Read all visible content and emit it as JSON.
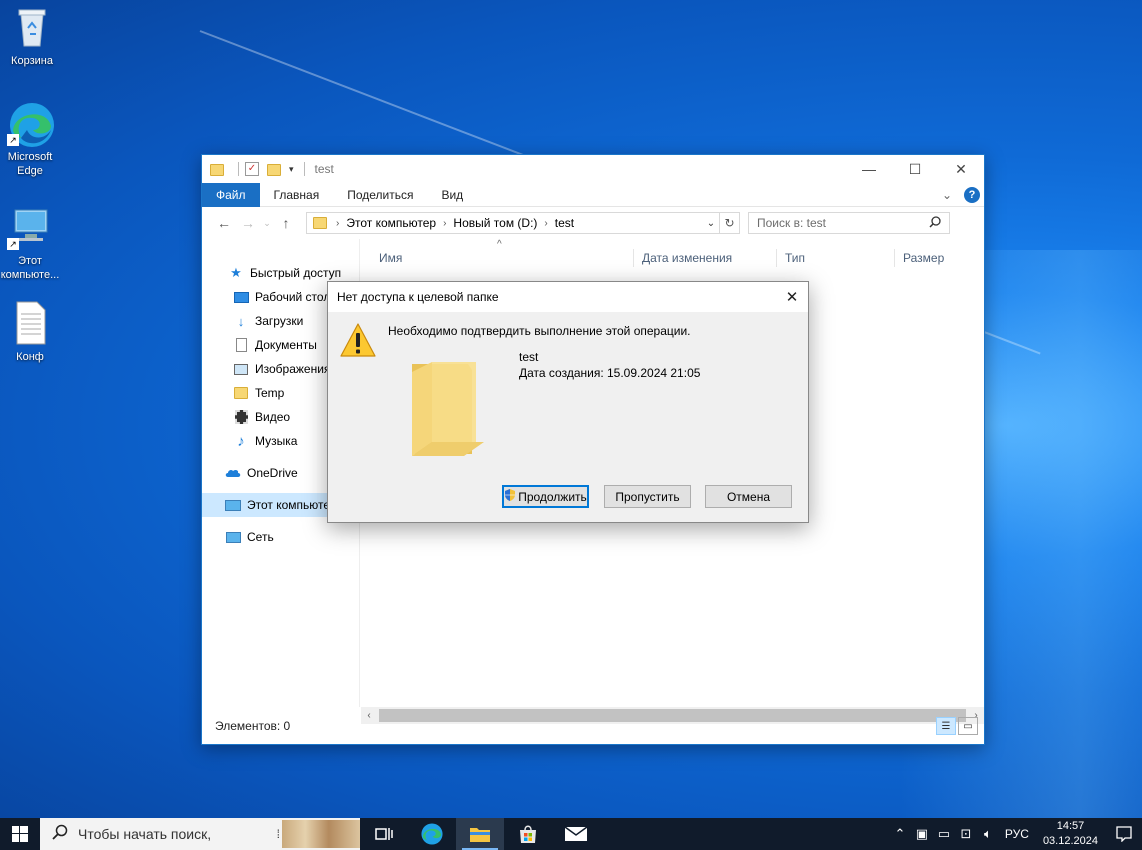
{
  "desktop": {
    "icons": [
      {
        "label": "Корзина"
      },
      {
        "label": "Microsoft Edge"
      },
      {
        "label": "Этот компьюте..."
      },
      {
        "label": "Конф"
      }
    ]
  },
  "explorer": {
    "title": "test",
    "ribbon_tabs": [
      "Файл",
      "Главная",
      "Поделиться",
      "Вид"
    ],
    "address": {
      "crumbs": [
        "Этот компьютер",
        "Новый том (D:)",
        "test"
      ]
    },
    "search_placeholder": "Поиск в: test",
    "nav_items": [
      {
        "label": "Быстрый доступ",
        "icon": "star-icon"
      },
      {
        "label": "Рабочий стол",
        "icon": "desktop-folder-icon"
      },
      {
        "label": "Загрузки",
        "icon": "download-icon"
      },
      {
        "label": "Документы",
        "icon": "documents-icon"
      },
      {
        "label": "Изображения",
        "icon": "pictures-icon"
      },
      {
        "label": "Temp",
        "icon": "folder-icon"
      },
      {
        "label": "Видео",
        "icon": "video-icon"
      },
      {
        "label": "Музыка",
        "icon": "music-icon"
      },
      {
        "label": "OneDrive",
        "icon": "cloud-icon"
      },
      {
        "label": "Этот компьютер",
        "icon": "computer-icon"
      },
      {
        "label": "Сеть",
        "icon": "network-icon"
      }
    ],
    "columns": [
      "Имя",
      "Дата изменения",
      "Тип",
      "Размер"
    ],
    "status": "Элементов: 0"
  },
  "dialog": {
    "title": "Нет доступа к целевой папке",
    "message": "Необходимо подтвердить выполнение этой операции.",
    "folder_name": "test",
    "created": "Дата создания: 15.09.2024 21:05",
    "buttons": {
      "continue": "Продолжить",
      "skip": "Пропустить",
      "cancel": "Отмена"
    }
  },
  "taskbar": {
    "search_placeholder": "Чтобы начать поиск,",
    "language": "РУС",
    "time": "14:57",
    "date": "03.12.2024"
  },
  "colors": {
    "accent": "#0078d7",
    "file_tab": "#1a6fc4",
    "taskbar": "#101b2b",
    "folder": "#f7d774"
  }
}
